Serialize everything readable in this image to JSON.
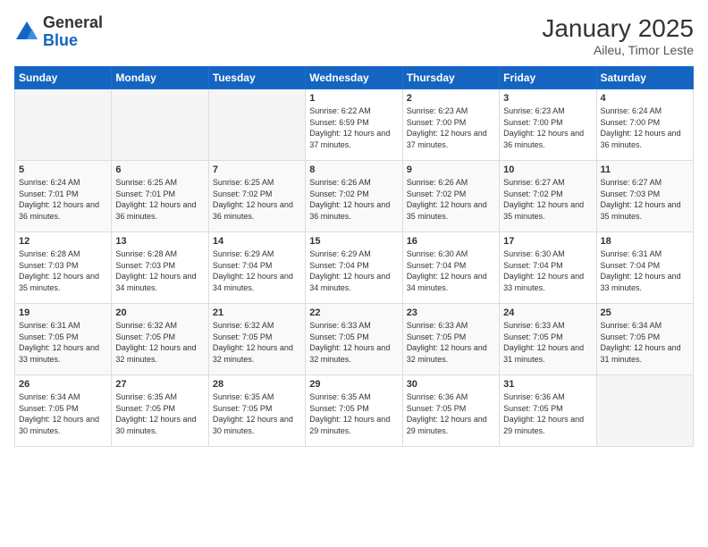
{
  "header": {
    "logo_general": "General",
    "logo_blue": "Blue",
    "title": "January 2025",
    "subtitle": "Aileu, Timor Leste"
  },
  "weekdays": [
    "Sunday",
    "Monday",
    "Tuesday",
    "Wednesday",
    "Thursday",
    "Friday",
    "Saturday"
  ],
  "weeks": [
    [
      {
        "day": "",
        "sunrise": "",
        "sunset": "",
        "daylight": "",
        "empty": true
      },
      {
        "day": "",
        "sunrise": "",
        "sunset": "",
        "daylight": "",
        "empty": true
      },
      {
        "day": "",
        "sunrise": "",
        "sunset": "",
        "daylight": "",
        "empty": true
      },
      {
        "day": "1",
        "sunrise": "Sunrise: 6:22 AM",
        "sunset": "Sunset: 6:59 PM",
        "daylight": "Daylight: 12 hours and 37 minutes.",
        "empty": false
      },
      {
        "day": "2",
        "sunrise": "Sunrise: 6:23 AM",
        "sunset": "Sunset: 7:00 PM",
        "daylight": "Daylight: 12 hours and 37 minutes.",
        "empty": false
      },
      {
        "day": "3",
        "sunrise": "Sunrise: 6:23 AM",
        "sunset": "Sunset: 7:00 PM",
        "daylight": "Daylight: 12 hours and 36 minutes.",
        "empty": false
      },
      {
        "day": "4",
        "sunrise": "Sunrise: 6:24 AM",
        "sunset": "Sunset: 7:00 PM",
        "daylight": "Daylight: 12 hours and 36 minutes.",
        "empty": false
      }
    ],
    [
      {
        "day": "5",
        "sunrise": "Sunrise: 6:24 AM",
        "sunset": "Sunset: 7:01 PM",
        "daylight": "Daylight: 12 hours and 36 minutes.",
        "empty": false
      },
      {
        "day": "6",
        "sunrise": "Sunrise: 6:25 AM",
        "sunset": "Sunset: 7:01 PM",
        "daylight": "Daylight: 12 hours and 36 minutes.",
        "empty": false
      },
      {
        "day": "7",
        "sunrise": "Sunrise: 6:25 AM",
        "sunset": "Sunset: 7:02 PM",
        "daylight": "Daylight: 12 hours and 36 minutes.",
        "empty": false
      },
      {
        "day": "8",
        "sunrise": "Sunrise: 6:26 AM",
        "sunset": "Sunset: 7:02 PM",
        "daylight": "Daylight: 12 hours and 36 minutes.",
        "empty": false
      },
      {
        "day": "9",
        "sunrise": "Sunrise: 6:26 AM",
        "sunset": "Sunset: 7:02 PM",
        "daylight": "Daylight: 12 hours and 35 minutes.",
        "empty": false
      },
      {
        "day": "10",
        "sunrise": "Sunrise: 6:27 AM",
        "sunset": "Sunset: 7:02 PM",
        "daylight": "Daylight: 12 hours and 35 minutes.",
        "empty": false
      },
      {
        "day": "11",
        "sunrise": "Sunrise: 6:27 AM",
        "sunset": "Sunset: 7:03 PM",
        "daylight": "Daylight: 12 hours and 35 minutes.",
        "empty": false
      }
    ],
    [
      {
        "day": "12",
        "sunrise": "Sunrise: 6:28 AM",
        "sunset": "Sunset: 7:03 PM",
        "daylight": "Daylight: 12 hours and 35 minutes.",
        "empty": false
      },
      {
        "day": "13",
        "sunrise": "Sunrise: 6:28 AM",
        "sunset": "Sunset: 7:03 PM",
        "daylight": "Daylight: 12 hours and 34 minutes.",
        "empty": false
      },
      {
        "day": "14",
        "sunrise": "Sunrise: 6:29 AM",
        "sunset": "Sunset: 7:04 PM",
        "daylight": "Daylight: 12 hours and 34 minutes.",
        "empty": false
      },
      {
        "day": "15",
        "sunrise": "Sunrise: 6:29 AM",
        "sunset": "Sunset: 7:04 PM",
        "daylight": "Daylight: 12 hours and 34 minutes.",
        "empty": false
      },
      {
        "day": "16",
        "sunrise": "Sunrise: 6:30 AM",
        "sunset": "Sunset: 7:04 PM",
        "daylight": "Daylight: 12 hours and 34 minutes.",
        "empty": false
      },
      {
        "day": "17",
        "sunrise": "Sunrise: 6:30 AM",
        "sunset": "Sunset: 7:04 PM",
        "daylight": "Daylight: 12 hours and 33 minutes.",
        "empty": false
      },
      {
        "day": "18",
        "sunrise": "Sunrise: 6:31 AM",
        "sunset": "Sunset: 7:04 PM",
        "daylight": "Daylight: 12 hours and 33 minutes.",
        "empty": false
      }
    ],
    [
      {
        "day": "19",
        "sunrise": "Sunrise: 6:31 AM",
        "sunset": "Sunset: 7:05 PM",
        "daylight": "Daylight: 12 hours and 33 minutes.",
        "empty": false
      },
      {
        "day": "20",
        "sunrise": "Sunrise: 6:32 AM",
        "sunset": "Sunset: 7:05 PM",
        "daylight": "Daylight: 12 hours and 32 minutes.",
        "empty": false
      },
      {
        "day": "21",
        "sunrise": "Sunrise: 6:32 AM",
        "sunset": "Sunset: 7:05 PM",
        "daylight": "Daylight: 12 hours and 32 minutes.",
        "empty": false
      },
      {
        "day": "22",
        "sunrise": "Sunrise: 6:33 AM",
        "sunset": "Sunset: 7:05 PM",
        "daylight": "Daylight: 12 hours and 32 minutes.",
        "empty": false
      },
      {
        "day": "23",
        "sunrise": "Sunrise: 6:33 AM",
        "sunset": "Sunset: 7:05 PM",
        "daylight": "Daylight: 12 hours and 32 minutes.",
        "empty": false
      },
      {
        "day": "24",
        "sunrise": "Sunrise: 6:33 AM",
        "sunset": "Sunset: 7:05 PM",
        "daylight": "Daylight: 12 hours and 31 minutes.",
        "empty": false
      },
      {
        "day": "25",
        "sunrise": "Sunrise: 6:34 AM",
        "sunset": "Sunset: 7:05 PM",
        "daylight": "Daylight: 12 hours and 31 minutes.",
        "empty": false
      }
    ],
    [
      {
        "day": "26",
        "sunrise": "Sunrise: 6:34 AM",
        "sunset": "Sunset: 7:05 PM",
        "daylight": "Daylight: 12 hours and 30 minutes.",
        "empty": false
      },
      {
        "day": "27",
        "sunrise": "Sunrise: 6:35 AM",
        "sunset": "Sunset: 7:05 PM",
        "daylight": "Daylight: 12 hours and 30 minutes.",
        "empty": false
      },
      {
        "day": "28",
        "sunrise": "Sunrise: 6:35 AM",
        "sunset": "Sunset: 7:05 PM",
        "daylight": "Daylight: 12 hours and 30 minutes.",
        "empty": false
      },
      {
        "day": "29",
        "sunrise": "Sunrise: 6:35 AM",
        "sunset": "Sunset: 7:05 PM",
        "daylight": "Daylight: 12 hours and 29 minutes.",
        "empty": false
      },
      {
        "day": "30",
        "sunrise": "Sunrise: 6:36 AM",
        "sunset": "Sunset: 7:05 PM",
        "daylight": "Daylight: 12 hours and 29 minutes.",
        "empty": false
      },
      {
        "day": "31",
        "sunrise": "Sunrise: 6:36 AM",
        "sunset": "Sunset: 7:05 PM",
        "daylight": "Daylight: 12 hours and 29 minutes.",
        "empty": false
      },
      {
        "day": "",
        "sunrise": "",
        "sunset": "",
        "daylight": "",
        "empty": true
      }
    ]
  ]
}
